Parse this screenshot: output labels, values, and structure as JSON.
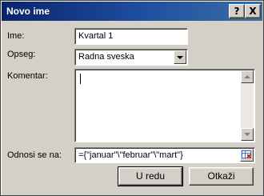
{
  "dialog": {
    "title": "Novo ime",
    "help_label": "?",
    "close_label": "X"
  },
  "form": {
    "name_label": "Ime:",
    "name_value": "Kvartal 1",
    "scope_label": "Opseg:",
    "scope_value": "Radna sveska",
    "comment_label": "Komentar:",
    "comment_value": "",
    "refers_label": "Odnosi se na:",
    "refers_value": "={\"januar\"\\\"februar\"\\\"mart\"}"
  },
  "buttons": {
    "ok_label": "U redu",
    "cancel_label": "Otkaži"
  }
}
